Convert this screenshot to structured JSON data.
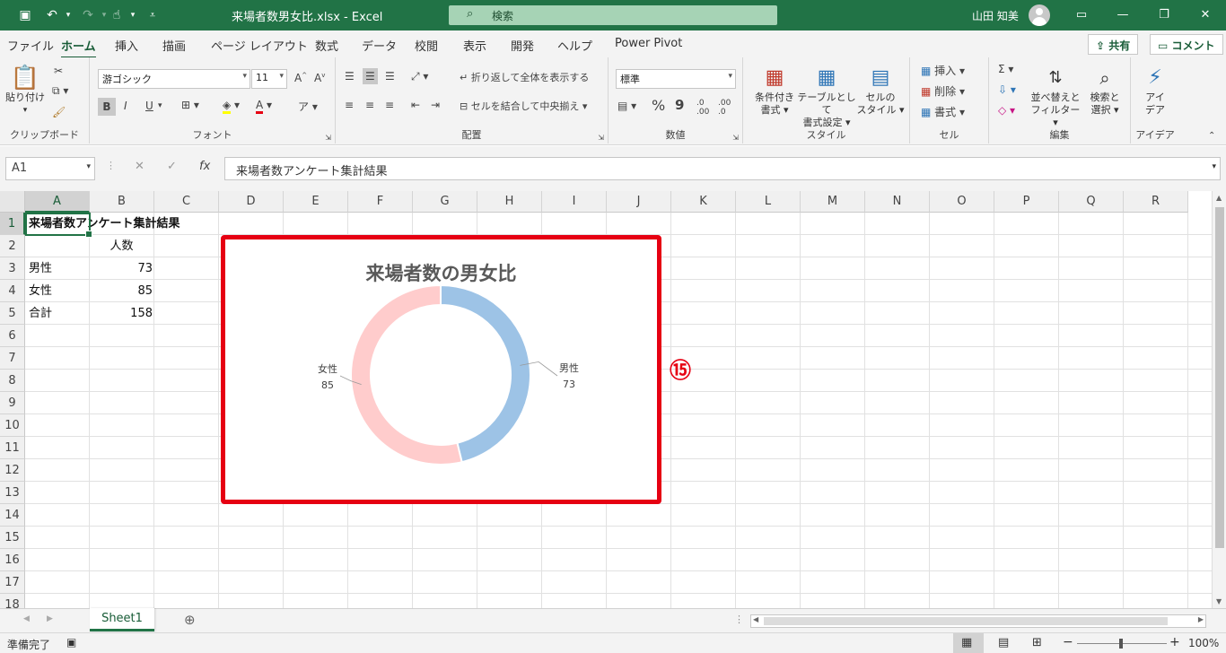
{
  "titlebar": {
    "filename": "来場者数男女比.xlsx",
    "separator": "-",
    "app": "Excel",
    "search_placeholder": "検索",
    "user": "山田 知美"
  },
  "tabs": [
    "ファイル",
    "ホーム",
    "挿入",
    "描画",
    "ページ レイアウト",
    "数式",
    "データ",
    "校閲",
    "表示",
    "開発",
    "ヘルプ",
    "Power Pivot"
  ],
  "active_tab": "ホーム",
  "share": {
    "share_label": "共有",
    "comment_label": "コメント"
  },
  "ribbon": {
    "clipboard": {
      "paste_label": "貼り付け",
      "group": "クリップボード"
    },
    "font": {
      "font_name": "游ゴシック",
      "font_size": "11",
      "group": "フォント",
      "bold": "B",
      "italic": "I",
      "underline": "U"
    },
    "alignment": {
      "wrap": "折り返して全体を表示する",
      "merge": "セルを結合して中央揃え",
      "group": "配置"
    },
    "number": {
      "format": "標準",
      "group": "数値",
      "percent": "%",
      "comma": "9"
    },
    "styles": {
      "conditional": [
        "条件付き",
        "書式"
      ],
      "table": [
        "テーブルとして",
        "書式設定"
      ],
      "cell": [
        "セルの",
        "スタイル"
      ],
      "group": "スタイル"
    },
    "cells": {
      "insert": "挿入",
      "delete": "削除",
      "format": "書式",
      "group": "セル"
    },
    "editing": {
      "sort": [
        "並べ替えと",
        "フィルター"
      ],
      "find": [
        "検索と",
        "選択"
      ],
      "group": "編集"
    },
    "ideas": {
      "label": [
        "アイ",
        "デア"
      ],
      "group": "アイデア"
    }
  },
  "formula_bar": {
    "name_box": "A1",
    "fx": "fx",
    "content": "来場者数アンケート集計結果"
  },
  "columns": [
    "A",
    "B",
    "C",
    "D",
    "E",
    "F",
    "G",
    "H",
    "I",
    "J",
    "K",
    "L",
    "M",
    "N",
    "O",
    "P",
    "Q",
    "R"
  ],
  "rows": [
    "1",
    "2",
    "3",
    "4",
    "5",
    "6",
    "7",
    "8",
    "9",
    "10",
    "11",
    "12",
    "13",
    "14",
    "15",
    "16",
    "17",
    "18"
  ],
  "cells": {
    "A1": "来場者数アンケート集計結果",
    "B2": "人数",
    "A3": "男性",
    "B3": "73",
    "A4": "女性",
    "B4": "85",
    "A5": "合計",
    "B5": "158"
  },
  "annotation_badge": "⑮",
  "sheet_tabs": [
    "Sheet1"
  ],
  "status": {
    "ready": "準備完了",
    "zoom": "100%"
  },
  "colors": {
    "excel_green": "#217346",
    "male": "#9dc3e6",
    "female": "#ffcccc",
    "highlight": "#e60012"
  },
  "chart_data": {
    "type": "pie",
    "subtype": "doughnut",
    "title": "来場者数の男女比",
    "categories": [
      "男性",
      "女性"
    ],
    "values": [
      73,
      85
    ],
    "colors": [
      "#9dc3e6",
      "#ffcccc"
    ],
    "data_labels": true,
    "legend": "none"
  }
}
